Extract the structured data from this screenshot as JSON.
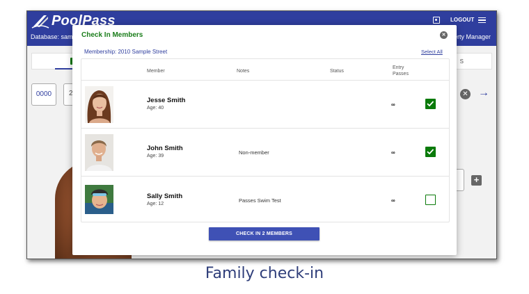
{
  "app": {
    "logo_text": "PoolPass",
    "database_label": "Database: samp",
    "role_label": "erty Manager",
    "logout_label": "LOGOUT"
  },
  "background": {
    "pin_value": "0000",
    "field_partial": "2",
    "field_label_partial": "M",
    "tab_right_label": "S"
  },
  "modal": {
    "title": "Check In Members",
    "membership": "Membership: 2010 Sample Street",
    "select_all": "Select All",
    "columns": {
      "member": "Member",
      "notes": "Notes",
      "status": "Status",
      "entry_passes_line1": "Entry",
      "entry_passes_line2": "Passes"
    },
    "members": [
      {
        "name": "Jesse Smith",
        "age": "Age: 40",
        "notes": "",
        "status": "",
        "passes": "∞",
        "checked": true
      },
      {
        "name": "John Smith",
        "age": "Age: 39",
        "notes": "Non-member",
        "status": "",
        "passes": "∞",
        "checked": true
      },
      {
        "name": "Sally Smith",
        "age": "Age: 12",
        "notes": "Passes Swim Test",
        "status": "",
        "passes": "∞",
        "checked": false
      }
    ],
    "checkin_button": "CHECK IN 2 MEMBERS"
  },
  "caption": "Family check-in",
  "colors": {
    "header": "#2f3e9e",
    "title_green": "#1a7d1a",
    "check_green": "#0a7a0a",
    "button_blue": "#3f51b5"
  },
  "icons": [
    "logo-icon",
    "account-icon",
    "menu-icon",
    "close-icon",
    "check-icon",
    "arrow-right-icon",
    "add-icon",
    "clear-icon"
  ]
}
